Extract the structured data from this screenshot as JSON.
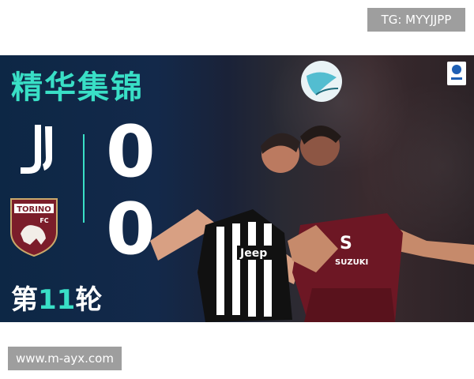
{
  "watermark_tg": "TG: MYYJJPP",
  "banner": {
    "headline": "精华集锦",
    "home_team_logo": "juventus-logo",
    "away_team_logo": "torino-logo",
    "away_logo_text": "TORINO",
    "home_score": "0",
    "away_score": "0",
    "round_prefix": "第",
    "round_number": "11",
    "round_suffix": "轮",
    "league_logo": "serie-a-logo",
    "accent_color": "#39dfc6"
  },
  "watermark_site": "www.m-ayx.com"
}
